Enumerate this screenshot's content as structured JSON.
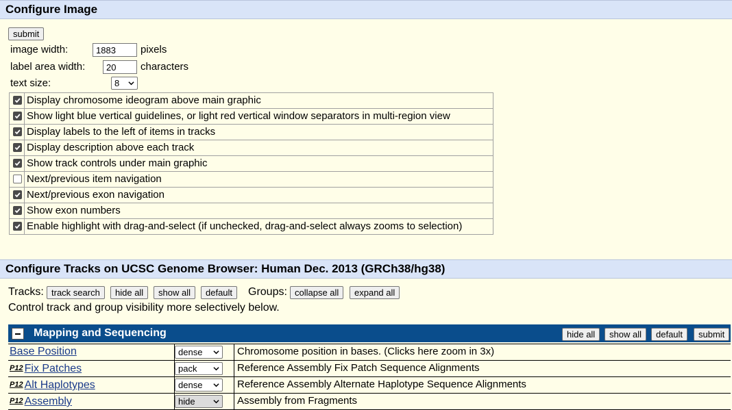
{
  "configure_image": {
    "header": "Configure Image",
    "submit_label": "submit",
    "image_width_label": "image width:",
    "image_width_value": "1883",
    "image_width_unit": "pixels",
    "label_area_label": "label area width:",
    "label_area_value": "20",
    "label_area_unit": "characters",
    "text_size_label": "text size:",
    "text_size_value": "8",
    "options": [
      {
        "label": "Display chromosome ideogram above main graphic",
        "checked": true
      },
      {
        "label": "Show light blue vertical guidelines, or light red vertical window separators in multi-region view",
        "checked": true
      },
      {
        "label": "Display labels to the left of items in tracks",
        "checked": true
      },
      {
        "label": "Display description above each track",
        "checked": true
      },
      {
        "label": "Show track controls under main graphic",
        "checked": true
      },
      {
        "label": "Next/previous item navigation",
        "checked": false
      },
      {
        "label": "Next/previous exon navigation",
        "checked": true
      },
      {
        "label": "Show exon numbers",
        "checked": true
      },
      {
        "label": "Enable highlight with drag-and-select (if unchecked, drag-and-select always zooms to selection)",
        "checked": true
      }
    ]
  },
  "configure_tracks": {
    "header": "Configure Tracks on UCSC Genome Browser: Human Dec. 2013 (GRCh38/hg38)",
    "tracks_label": "Tracks:",
    "track_search": "track search",
    "hide_all": "hide all",
    "show_all": "show all",
    "default": "default",
    "groups_label": "Groups:",
    "collapse_all": "collapse all",
    "expand_all": "expand all",
    "note": "Control track and group visibility more selectively below."
  },
  "group": {
    "title": "Mapping and Sequencing",
    "hide_all": "hide all",
    "show_all": "show all",
    "default": "default",
    "submit": "submit",
    "tracks": [
      {
        "badge": "",
        "name": "Base Position",
        "visibility": "dense",
        "description": "Chromosome position in bases. (Clicks here zoom in 3x)"
      },
      {
        "badge": "P12",
        "name": "Fix Patches",
        "visibility": "pack",
        "description": "Reference Assembly Fix Patch Sequence Alignments"
      },
      {
        "badge": "P12",
        "name": "Alt Haplotypes",
        "visibility": "dense",
        "description": "Reference Assembly Alternate Haplotype Sequence Alignments"
      },
      {
        "badge": "P12",
        "name": "Assembly",
        "visibility": "hide",
        "description": "Assembly from Fragments"
      }
    ]
  }
}
